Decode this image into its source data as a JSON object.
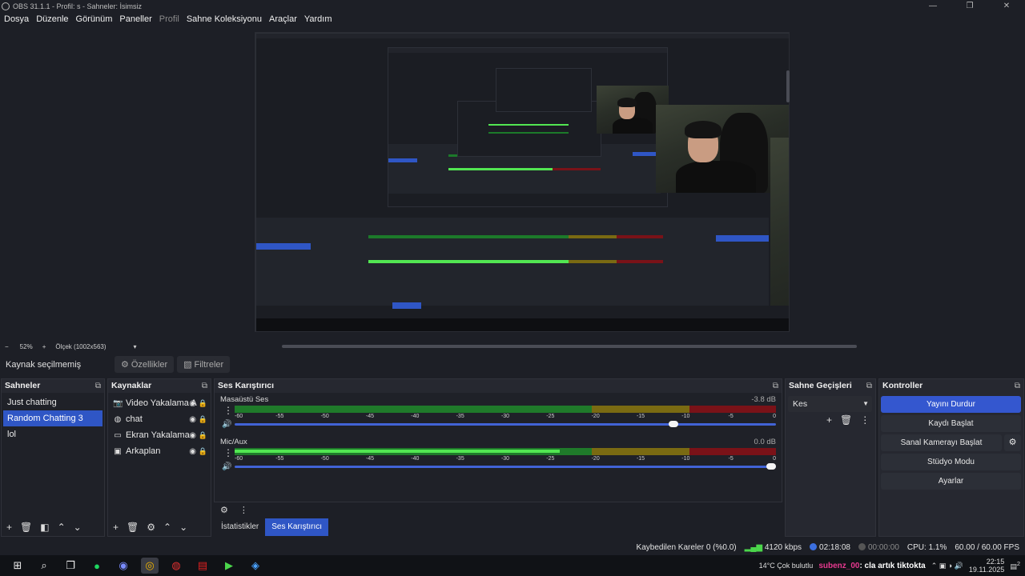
{
  "window": {
    "title": "OBS 31.1.1 - Profil: s - Sahneler: İsimsiz",
    "controls": [
      "—",
      "❐",
      "✕"
    ]
  },
  "menu": [
    {
      "label": "Dosya",
      "enabled": true
    },
    {
      "label": "Düzenle",
      "enabled": true
    },
    {
      "label": "Görünüm",
      "enabled": true
    },
    {
      "label": "Paneller",
      "enabled": true
    },
    {
      "label": "Profil",
      "enabled": false
    },
    {
      "label": "Sahne Koleksiyonu",
      "enabled": true
    },
    {
      "label": "Araçlar",
      "enabled": true
    },
    {
      "label": "Yardım",
      "enabled": true
    }
  ],
  "preview": {
    "zoom": "52%",
    "scale_label": "Ölçek (1002x563)",
    "minus": "−",
    "plus": "+",
    "caret": "▾"
  },
  "source_toolbar": {
    "no_selection": "Kaynak seçilmemiş",
    "properties": "Özellikler",
    "filters": "Filtreler"
  },
  "scenes": {
    "title": "Sahneler",
    "items": [
      "Just chatting",
      "Random Chatting 3",
      "lol"
    ],
    "selected_index": 1
  },
  "sources": {
    "title": "Kaynaklar",
    "items": [
      {
        "label": "Video Yakalama A",
        "icon": "camera-icon"
      },
      {
        "label": "chat",
        "icon": "globe-icon"
      },
      {
        "label": "Ekran Yakalama",
        "icon": "monitor-icon"
      },
      {
        "label": "Arkaplan",
        "icon": "image-icon"
      }
    ]
  },
  "mixer": {
    "title": "Ses Karıştırıcı",
    "tracks": [
      {
        "name": "Masaüstü Ses",
        "db": "-3.8 dB",
        "level": 0.0,
        "volume": 0.82
      },
      {
        "name": "Mic/Aux",
        "db": "0.0 dB",
        "level": 0.6,
        "volume": 1.0
      }
    ],
    "ticks": [
      "-60",
      "-55",
      "-50",
      "-45",
      "-40",
      "-35",
      "-30",
      "-25",
      "-20",
      "-15",
      "-10",
      "-5",
      "0"
    ]
  },
  "bottom_tabs": [
    "İstatistikler",
    "Ses Karıştırıcı"
  ],
  "transitions": {
    "title": "Sahne Geçişleri",
    "selected": "Kes"
  },
  "controls": {
    "title": "Kontroller",
    "stop_stream": "Yayını Durdur",
    "start_record": "Kaydı Başlat",
    "virtual_cam": "Sanal Kamerayı Başlat",
    "studio_mode": "Stüdyo Modu",
    "settings": "Ayarlar"
  },
  "status": {
    "dropped": "Kaybedilen Kareler 0 (%0.0)",
    "bitrate": "4120 kbps",
    "stream_time": "02:18:08",
    "rec_time": "00:00:00",
    "cpu": "CPU: 1.1%",
    "fps": "60.00 / 60.00 FPS"
  },
  "taskbar": {
    "ticker_user": "subenz_00",
    "ticker_text": ": cla artık tiktokta",
    "ticker_prefix": "14°C Çok bulutlu",
    "time": "22:15",
    "date": "19.11.2025",
    "notif_count": "2"
  },
  "colors": {
    "accent": "#2f56c5",
    "meter_green": "#52e652",
    "meter_yellow": "#7a6a12",
    "meter_red": "#7a1218",
    "bg": "#1d1f26"
  }
}
